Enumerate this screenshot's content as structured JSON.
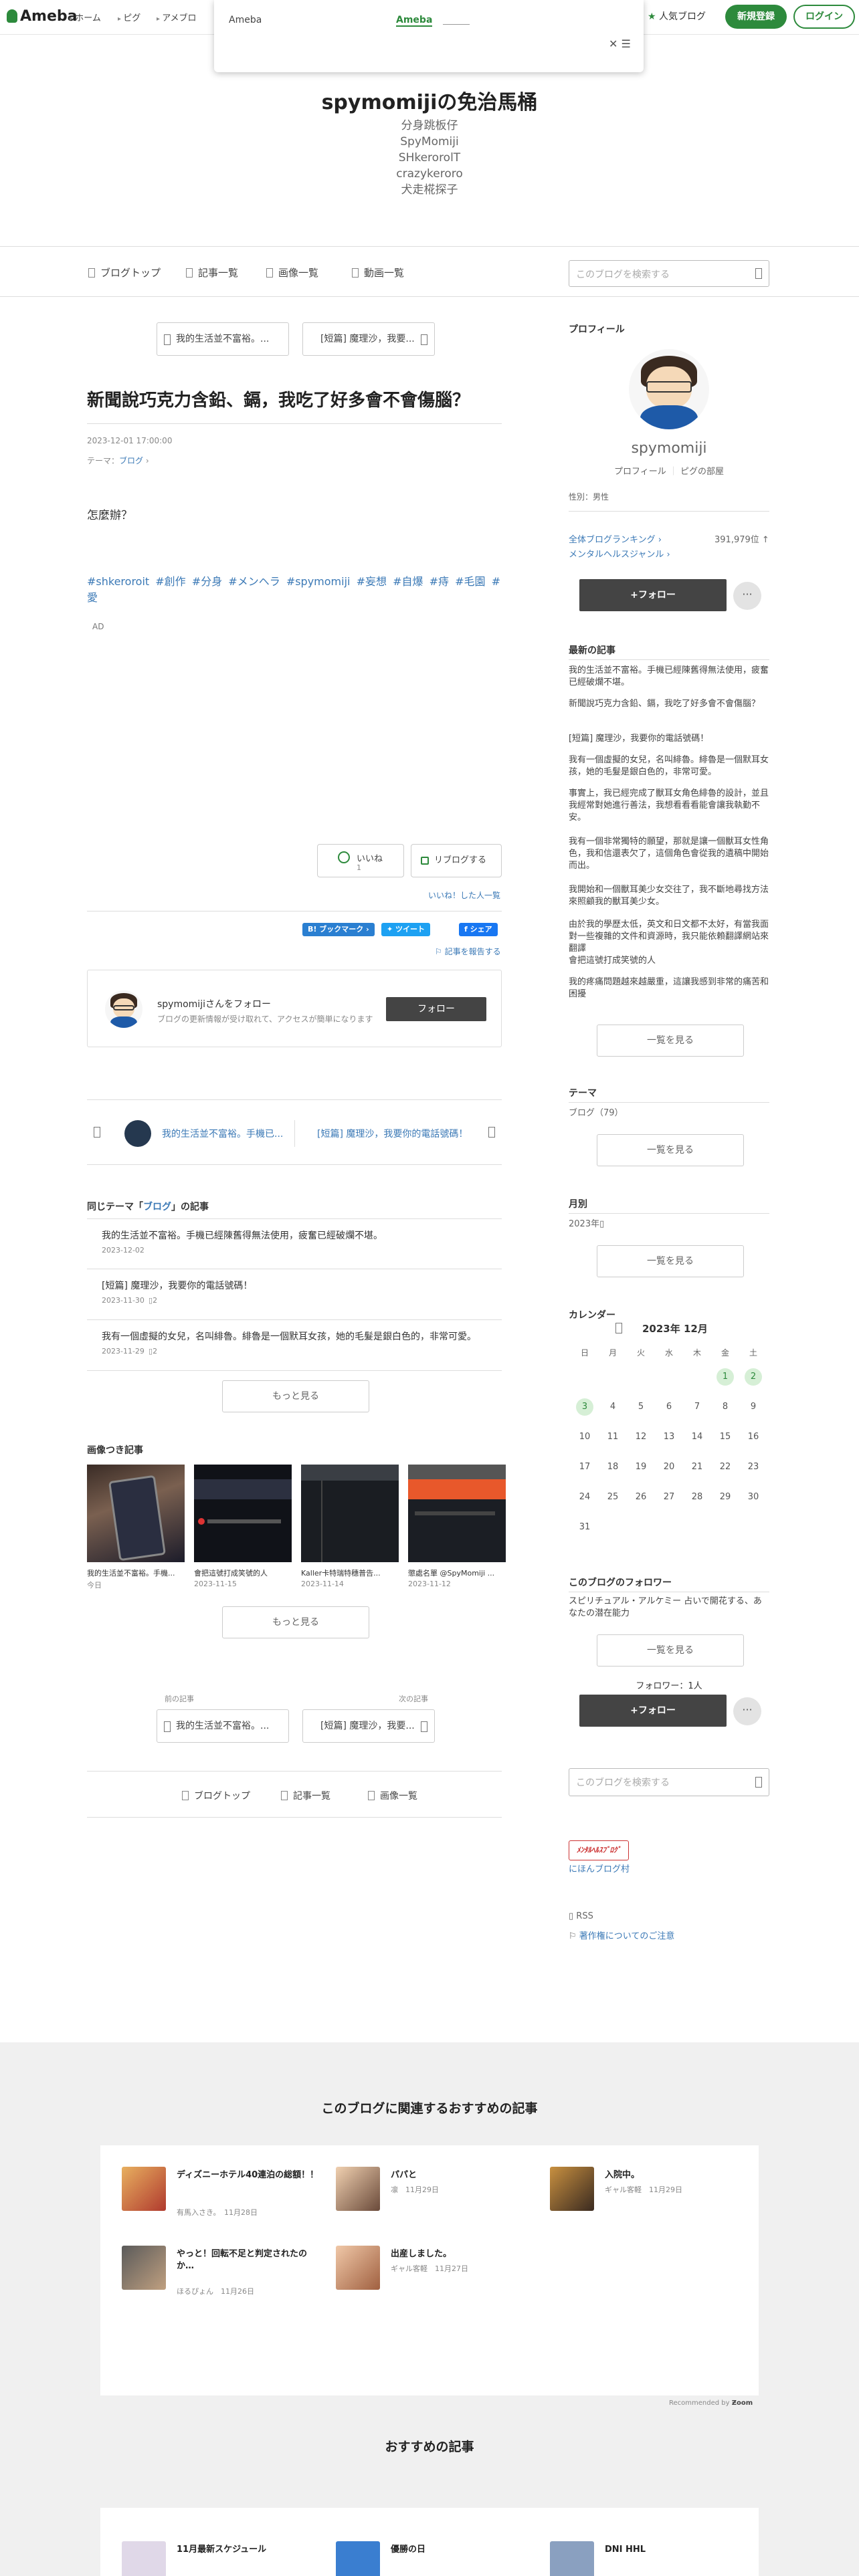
{
  "header": {
    "logo": "Ameba",
    "nav": [
      "ホーム",
      "ピグ",
      "アメブロ"
    ],
    "popup_label": "Ameba",
    "popup_link": "Ameba",
    "popular": "人気ブログ",
    "signup": "新規登録",
    "login": "ログイン",
    "accent_color": "#2d8a3c"
  },
  "blog": {
    "title": "spymomijiの免治馬桶",
    "subtitle": [
      "分身跳板仔",
      "SpyMomiji",
      "SHkerorolT",
      "crazykeroro",
      "犬走椛探子"
    ]
  },
  "blognav": {
    "items": [
      "ブログトップ",
      "記事一覧",
      "画像一覧",
      "動画一覧"
    ],
    "search_placeholder": "このブログを検索する"
  },
  "article": {
    "prev_top": "我的生活並不富裕。...",
    "next_top": "[短篇] 魔理沙，我要...",
    "title": "新聞說巧克力含鉛、鎘，我吃了好多會不會傷腦？",
    "date": "2023-12-01 17:00:00",
    "theme_label": "テーマ：",
    "theme": "ブログ",
    "body": "怎麼辦？",
    "hashtags": [
      "#shkeroroit",
      "#創作",
      "#分身",
      "#メンヘラ",
      "#spymomiji",
      "#妄想",
      "#自爆",
      "#痔",
      "#毛園",
      "#愛"
    ],
    "ad": "AD",
    "like": "いいね",
    "like_count": "1",
    "reblog": "リブログする",
    "liked_link": "いいね！した人一覧",
    "share_hatena": "B! ブックマーク",
    "share_tweet": "ツイート",
    "share_fb": "シェア",
    "report": "記事を報告する"
  },
  "followcard": {
    "name": "spymomijiさんをフォロー",
    "desc": "ブログの更新情報が受け取れて、アクセスが簡単になります",
    "button": "フォロー"
  },
  "pager": {
    "prev": "我的生活並不富裕。手機已...",
    "next": "[短篇] 魔理沙，我要你的電話號碼！"
  },
  "same_theme": {
    "head_pre": "同じテーマ「",
    "head_theme": "ブログ",
    "head_post": "」の記事",
    "items": [
      {
        "title": "我的生活並不富裕。手機已經陳舊得無法使用，疲奮已經破爛不堪。",
        "date": "2023-12-02",
        "count": ""
      },
      {
        "title": "[短篇] 魔理沙，我要你的電話號碼！",
        "date": "2023-11-30",
        "count": "2"
      },
      {
        "title": "我有一個虛擬的女兒，名叫緋魯。緋魯是一個默耳女孩，她的毛髮是銀白色的，非常可愛。",
        "date": "2023-11-29",
        "count": "2"
      }
    ],
    "more": "もっと見る"
  },
  "images": {
    "head": "画像つき記事",
    "items": [
      {
        "caption": "我的生活並不富裕。手機...",
        "date": "今日"
      },
      {
        "caption": "會把這號打成笑號的人",
        "date": "2023-11-15"
      },
      {
        "caption": "Kaller卡特瑞特穗普告...",
        "date": "2023-11-14"
      },
      {
        "caption": "懲處名單 @SpyMomiji ...",
        "date": "2023-11-12"
      }
    ],
    "more": "もっと見る"
  },
  "prevnext": {
    "prev_label": "前の記事",
    "next_label": "次の記事",
    "prev": "我的生活並不富裕。...",
    "next": "[短篇] 魔理沙，我要..."
  },
  "bottomnav": [
    "ブログトップ",
    "記事一覧",
    "画像一覧"
  ],
  "sidebar": {
    "profile_head": "プロフィール",
    "name": "spymomiji",
    "profile_link": "プロフィール",
    "pig_link": "ピグの部屋",
    "gender": "性別：男性",
    "rank1": "全体ブログランキング",
    "rank1_value": "391,979位",
    "rank2": "メンタルヘルスジャンル",
    "follow": "+フォロー",
    "recent_head": "最新の記事",
    "recent": [
      "我的生活並不富裕。手機已經陳舊得無法使用，疲奮已經破爛不堪。",
      "新聞說巧克力含鉛、鎘，我吃了好多會不會傷腦？",
      "[短篇] 魔理沙，我要你的電話號碼！",
      "我有一個虛擬的女兒，名叫緋魯。緋魯是一個默耳女孩，她的毛髮是銀白色的，非常可愛。",
      "事實上，我已經完成了獸耳女角色緋魯的設計，並且我經常對她進行善法，我想看看看能會讓我執勤不安。",
      "我有一個非常獨特的願望，那就是讓一個獸耳女性角色，我和信還表欠了，這個角色會從我的遺稿中開始而出。",
      "我開始和一個獸耳美少女交往了，我不斷地尋找方法來照顧我的獸耳美少女。",
      "由於我的學歷太低，英文和日文都不太好，有當我面對一些複雜的文件和資源時，我只能依賴翻譯網站來翻譯",
      "會把這號打成笑號的人",
      "我的疼痛問題越來越嚴重，這讓我感到非常的痛苦和困擾"
    ],
    "recent_more": "一覧を見る",
    "theme_head": "テーマ",
    "theme_item": "ブログ（79）",
    "theme_more": "一覧を見る",
    "monthly_head": "月別",
    "monthly_item": "2023年",
    "monthly_more": "一覧を見る",
    "calendar_head": "カレンダー",
    "calendar_title": "2023年 12月",
    "weekdays": [
      "日",
      "月",
      "火",
      "水",
      "木",
      "金",
      "土"
    ],
    "days": [
      "1",
      "2",
      "3",
      "4",
      "5",
      "6",
      "7",
      "8",
      "9",
      "10",
      "11",
      "12",
      "13",
      "14",
      "15",
      "16",
      "17",
      "18",
      "19",
      "20",
      "21",
      "22",
      "23",
      "24",
      "25",
      "26",
      "27",
      "28",
      "29",
      "30",
      "31"
    ],
    "highlight_days": [
      1,
      2,
      3
    ],
    "followers_head": "このブログのフォロワー",
    "followers_desc": "スピリチュアル・アルケミー 占いで開花する、あなたの潜在能力",
    "followers_more": "一覧を見る",
    "follower_count": "フォロワー：1人",
    "follow2": "+フォロー",
    "search_placeholder": "このブログを検索する",
    "mh_badge": "ﾒﾝﾀﾙﾍﾙｽﾌﾞﾛｸﾞ",
    "mh_link": "にほんブログ村",
    "rss": "RSS",
    "copyright": "著作権についてのご注意"
  },
  "footer": {
    "head1": "このブログに関連するおすすめの記事",
    "recs": [
      {
        "title": "ディズニーホテル40連泊の総額！！",
        "author": "有馬入さき。",
        "date": "11月28日"
      },
      {
        "title": "パパと",
        "author": "凛",
        "date": "11月29日"
      },
      {
        "title": "入院中。",
        "author": "ギャル客軽",
        "date": "11月29日"
      },
      {
        "title": "やっと！回転不足と判定されたのか…",
        "author": "ほるぴょん",
        "date": "11月26日"
      },
      {
        "title": "出産しました。",
        "author": "ギャル客軽",
        "date": "11月27日"
      }
    ],
    "recommended": "Recommended by",
    "head2": "おすすめの記事",
    "recs2": [
      {
        "title": "11月最新スケジュール"
      },
      {
        "title": "優勝の日"
      },
      {
        "title": "DNI HHL"
      }
    ]
  }
}
